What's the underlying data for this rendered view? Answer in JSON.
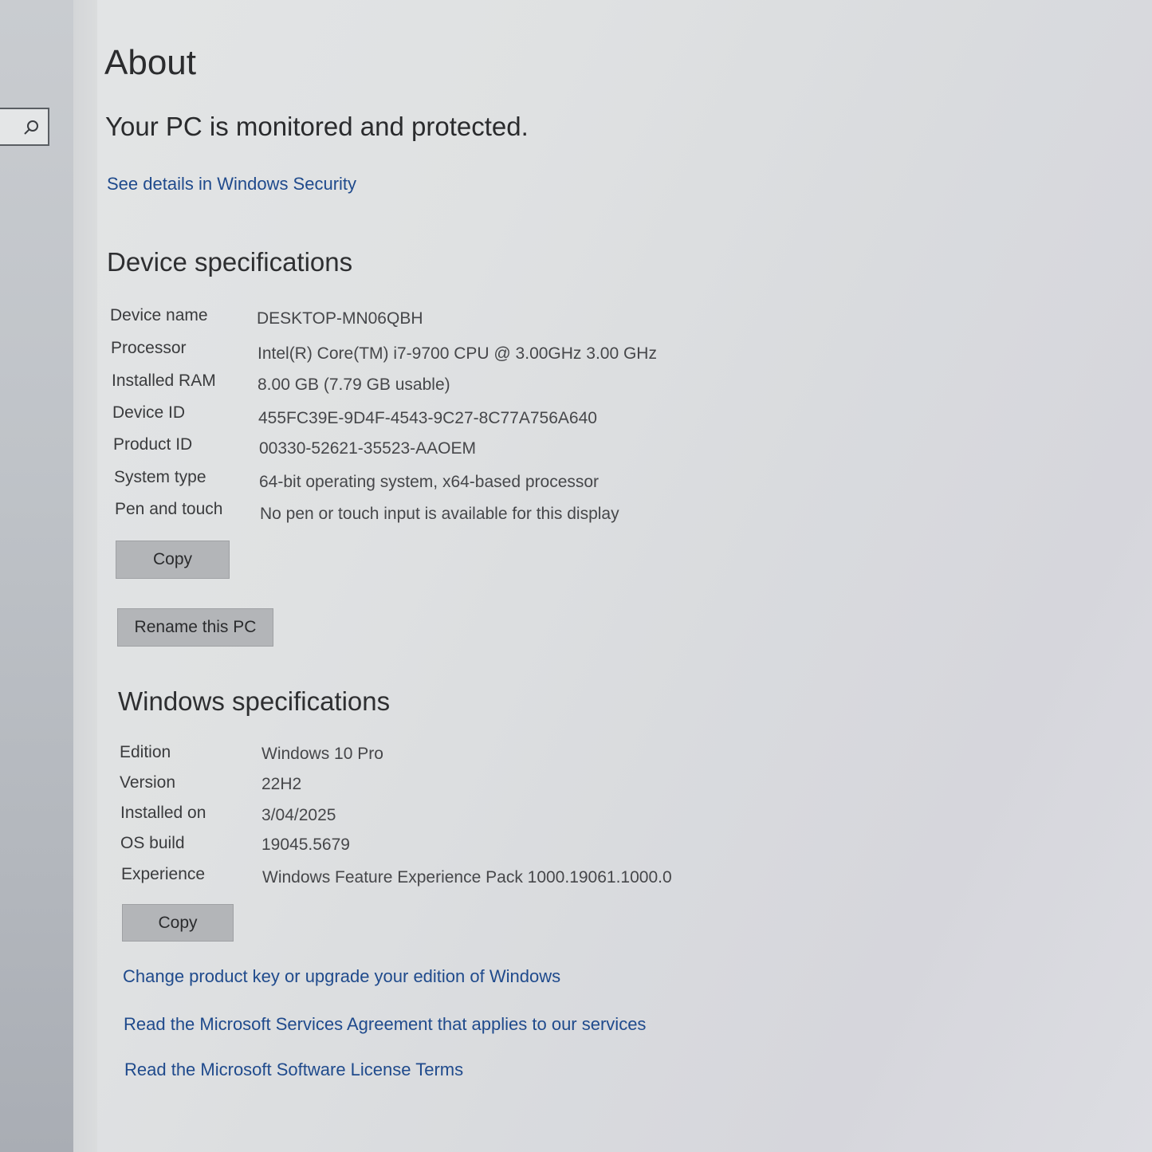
{
  "page": {
    "title": "About",
    "protection_status": "Your PC is monitored and protected.",
    "security_link": "See details in Windows Security"
  },
  "sidebar": {
    "search_icon": "search-icon"
  },
  "device_specs": {
    "heading": "Device specifications",
    "rows": [
      {
        "label": "Device name",
        "value": "DESKTOP-MN06QBH"
      },
      {
        "label": "Processor",
        "value": "Intel(R) Core(TM) i7-9700 CPU @ 3.00GHz   3.00 GHz"
      },
      {
        "label": "Installed RAM",
        "value": "8.00 GB (7.79 GB usable)"
      },
      {
        "label": "Device ID",
        "value": "455FC39E-9D4F-4543-9C27-8C77A756A640"
      },
      {
        "label": "Product ID",
        "value": "00330-52621-35523-AAOEM"
      },
      {
        "label": "System type",
        "value": "64-bit operating system, x64-based processor"
      },
      {
        "label": "Pen and touch",
        "value": "No pen or touch input is available for this display"
      }
    ],
    "copy_label": "Copy",
    "rename_label": "Rename this PC"
  },
  "windows_specs": {
    "heading": "Windows specifications",
    "rows": [
      {
        "label": "Edition",
        "value": "Windows 10 Pro"
      },
      {
        "label": "Version",
        "value": "22H2"
      },
      {
        "label": "Installed on",
        "value": "3/04/2025"
      },
      {
        "label": "OS build",
        "value": "19045.5679"
      },
      {
        "label": "Experience",
        "value": "Windows Feature Experience Pack 1000.19061.1000.0"
      }
    ],
    "copy_label": "Copy"
  },
  "links": {
    "product_key": "Change product key or upgrade your edition of Windows",
    "services_agreement": "Read the Microsoft Services Agreement that applies to our services",
    "license_terms": "Read the Microsoft Software License Terms"
  },
  "colors": {
    "link": "#1f4a8c",
    "button": "#b3b5b8",
    "background": "#dfe1e2"
  }
}
